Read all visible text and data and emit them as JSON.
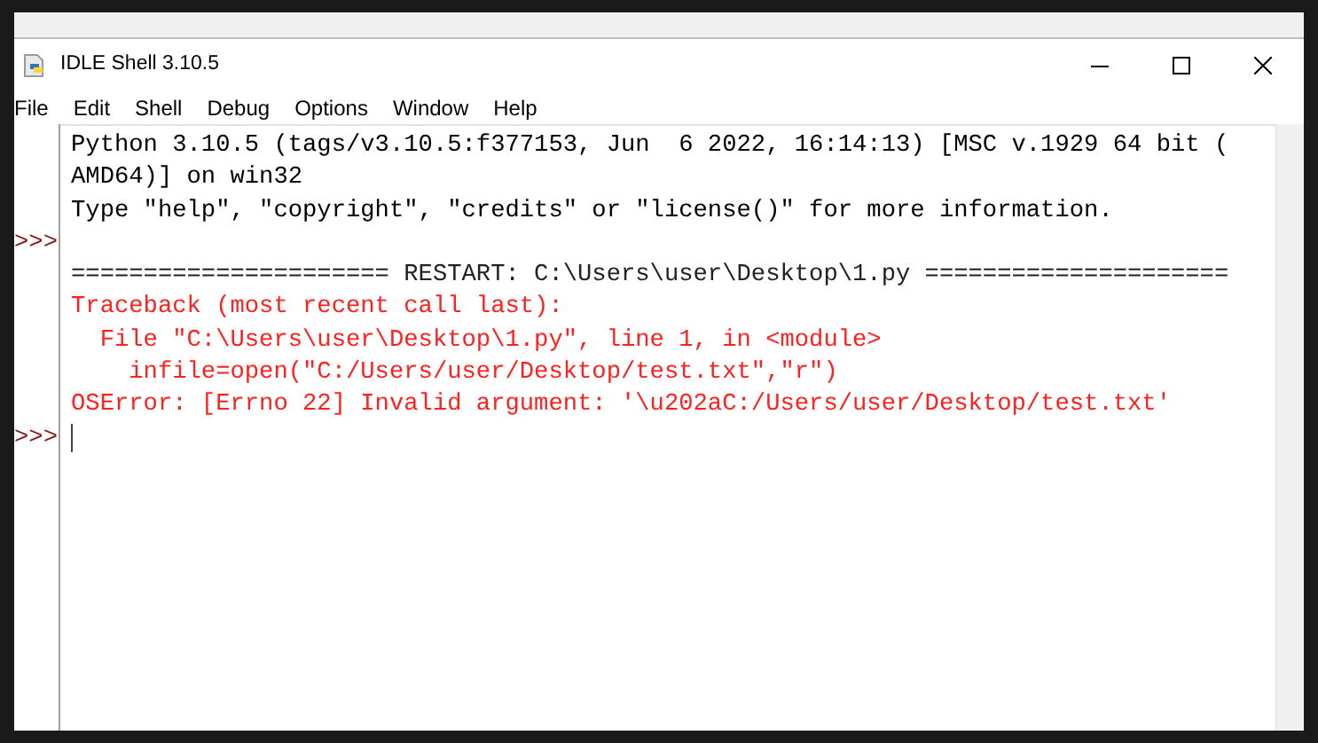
{
  "window": {
    "title": "IDLE Shell 3.10.5"
  },
  "menu": [
    "File",
    "Edit",
    "Shell",
    "Debug",
    "Options",
    "Window",
    "Help"
  ],
  "shell": {
    "lines": [
      {
        "kind": "output",
        "text": "Python 3.10.5 (tags/v3.10.5:f377153, Jun  6 2022, 16:14:13) [MSC v.1929 64 bit ("
      },
      {
        "kind": "output",
        "text": "AMD64)] on win32"
      },
      {
        "kind": "output",
        "text": "Type \"help\", \"copyright\", \"credits\" or \"license()\" for more information."
      },
      {
        "kind": "prompt",
        "prompt": ">>>"
      },
      {
        "kind": "restart",
        "text": "====================== RESTART: C:\\Users\\user\\Desktop\\1.py ====================="
      },
      {
        "kind": "error",
        "text": "Traceback (most recent call last):"
      },
      {
        "kind": "error",
        "text": "  File \"C:\\Users\\user\\Desktop\\1.py\", line 1, in <module>"
      },
      {
        "kind": "error",
        "text": "    infile=open(\"C:/Users/user/Desktop/test.txt\",\"r\")"
      },
      {
        "kind": "error",
        "text": "OSError: [Errno 22] Invalid argument: '\\u202aC:/Users/user/Desktop/test.txt'"
      },
      {
        "kind": "prompt",
        "prompt": ">>>",
        "cursor": true
      }
    ]
  }
}
